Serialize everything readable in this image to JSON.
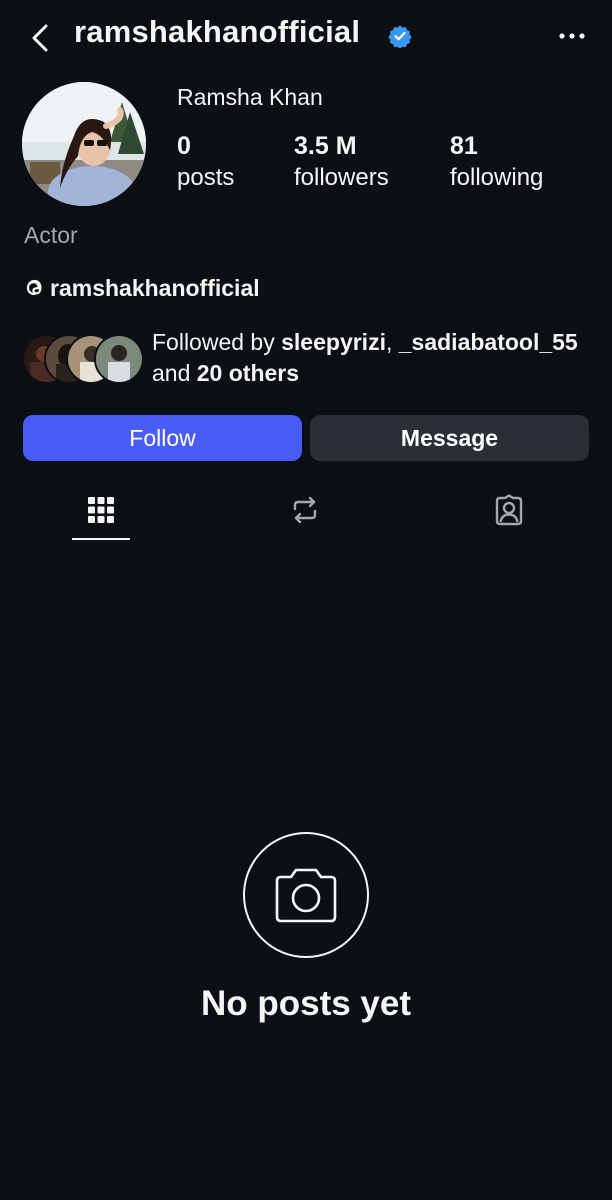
{
  "header": {
    "username": "ramshakhanofficial"
  },
  "profile": {
    "display_name": "Ramsha Khan",
    "category": "Actor",
    "threads_handle": "ramshakhanofficial"
  },
  "stats": {
    "posts": {
      "value": "0",
      "label": "posts"
    },
    "followers": {
      "value": "3.5 M",
      "label": "followers"
    },
    "following": {
      "value": "81",
      "label": "following"
    }
  },
  "followed_by": {
    "prefix": "Followed by",
    "user1": "sleepyrizi",
    "user2": "_sadiabatool_55",
    "joiner": "and",
    "others": "20 others"
  },
  "actions": {
    "follow_label": "Follow",
    "message_label": "Message"
  },
  "tabs": [
    {
      "icon": "grid-icon",
      "active": true
    },
    {
      "icon": "repost-icon",
      "active": false
    },
    {
      "icon": "tagged-icon",
      "active": false
    }
  ],
  "empty_state": {
    "icon": "camera-icon",
    "text": "No posts yet"
  },
  "colors": {
    "background": "#0c1014",
    "follow_button": "#4a5cf8",
    "message_button": "#2a2f35",
    "verified_badge": "#3897f0",
    "muted_text": "#a3a8ad"
  }
}
